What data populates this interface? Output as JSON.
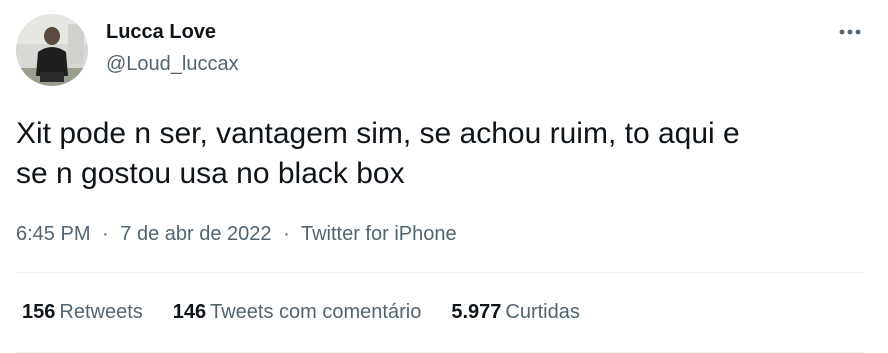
{
  "author": {
    "name": "Lucca Love",
    "handle": "@Loud_luccax"
  },
  "tweet": {
    "text_line1": "Xit pode n ser, vantagem sim, se achou ruim, to aqui e",
    "text_line2": "se n gostou usa no black box",
    "time": "6:45 PM",
    "date": "7 de abr de 2022",
    "source": "Twitter for iPhone",
    "separator": "·"
  },
  "stats": {
    "retweets": {
      "count": "156",
      "label": "Retweets"
    },
    "quotes": {
      "count": "146",
      "label": "Tweets com comentário"
    },
    "likes": {
      "count": "5.977",
      "label": "Curtidas"
    }
  },
  "icons": {
    "more": "more-horizontal-icon"
  },
  "colors": {
    "text_primary": "#0f1419",
    "text_secondary": "#536471",
    "divider": "#eff3f4"
  }
}
